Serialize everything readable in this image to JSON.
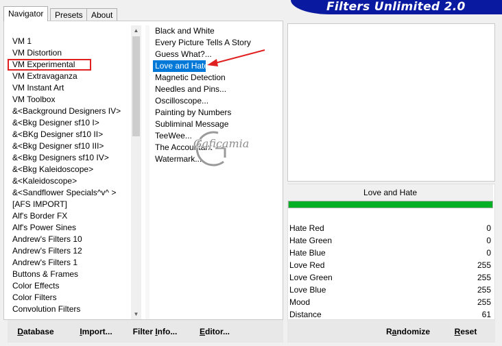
{
  "tabs": [
    {
      "label": "Navigator"
    },
    {
      "label": "Presets"
    },
    {
      "label": "About"
    }
  ],
  "app_title": "Filters Unlimited 2.0",
  "categories": [
    "VM 1",
    "VM Distortion",
    "VM Experimental",
    "VM Extravaganza",
    "VM Instant Art",
    "VM Toolbox",
    "&<Background Designers IV>",
    "&<Bkg Designer sf10 I>",
    "&<BKg Designer sf10 II>",
    "&<Bkg Designer sf10 III>",
    "&<Bkg Designers sf10 IV>",
    "&<Bkg Kaleidoscope>",
    "&<Kaleidoscope>",
    "&<Sandflower Specials^v^ >",
    "[AFS IMPORT]",
    "Alf's Border FX",
    "Alf's Power Sines",
    "Andrew's Filters 10",
    "Andrew's Filters 12",
    "Andrew's Filters 1",
    "Buttons & Frames",
    "Color Effects",
    "Color Filters",
    "Convolution Filters"
  ],
  "selected_category": "VM Experimental",
  "filters": [
    "Black and White",
    "Every Picture Tells A Story",
    "Guess  What?...",
    "Love and Hate",
    "Magnetic Detection",
    "Needles and Pins...",
    "Oscilloscope...",
    "Painting by Numbers",
    "Subliminal Message",
    "TeeWee...",
    "The Accountant",
    "Watermark..."
  ],
  "selected_filter": "Love and Hate",
  "watermark": "Gaficamia",
  "current_filter_name": "Love and Hate",
  "progress_fraction": 1.0,
  "params": [
    {
      "name": "Hate Red",
      "value": "0"
    },
    {
      "name": "Hate Green",
      "value": "0"
    },
    {
      "name": "Hate Blue",
      "value": "0"
    },
    {
      "name": "Love Red",
      "value": "255"
    },
    {
      "name": "Love Green",
      "value": "255"
    },
    {
      "name": "Love Blue",
      "value": "255"
    },
    {
      "name": "Mood",
      "value": "255"
    },
    {
      "name": "Distance",
      "value": "61"
    }
  ],
  "buttons": {
    "database": {
      "first": "D",
      "rest": "atabase"
    },
    "import": {
      "first": "I",
      "rest": "mport..."
    },
    "filter_info": {
      "pre": "Filter ",
      "u": "I",
      "rest": "nfo..."
    },
    "editor": {
      "first": "E",
      "rest": "ditor..."
    },
    "randomize": {
      "pre": "R",
      "u": "a",
      "rest": "ndomize"
    },
    "reset": {
      "first": "R",
      "rest": "eset"
    }
  },
  "colors": {
    "selection": "#0078d7",
    "highlight_box": "#e02020",
    "annotation_arrow": "#e02020",
    "title_banner": "#0a1aa0",
    "progress": "#06b025"
  }
}
